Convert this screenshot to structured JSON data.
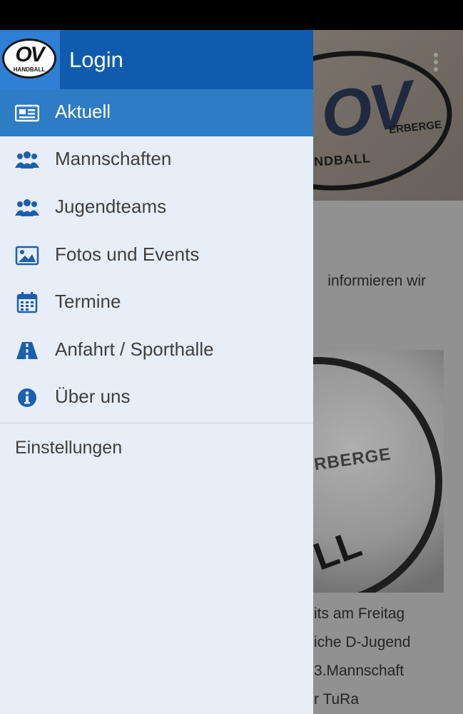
{
  "header": {
    "title": "Login",
    "logo_ov": "OV",
    "logo_handball": "HANDBALL"
  },
  "nav": {
    "items": [
      {
        "label": "Aktuell",
        "icon": "newspaper-icon",
        "active": true
      },
      {
        "label": "Mannschaften",
        "icon": "users-icon"
      },
      {
        "label": "Jugendteams",
        "icon": "users-icon"
      },
      {
        "label": "Fotos und Events",
        "icon": "image-icon"
      },
      {
        "label": "Termine",
        "icon": "calendar-icon"
      },
      {
        "label": "Anfahrt / Sporthalle",
        "icon": "road-icon"
      },
      {
        "label": "Über uns",
        "icon": "info-icon"
      }
    ],
    "settings_label": "Einstellungen"
  },
  "background": {
    "hero": {
      "logo_ov": "OV",
      "logo_erberge": "ERBERGE",
      "logo_handball": "NDBALL"
    },
    "intro_line": "informieren wir",
    "intro_end": ".",
    "image_text": {
      "erberge": "RBERGE",
      "ll": "LL"
    },
    "news_lines": [
      "its am Freitag",
      "iche D-Jugend",
      "3.Mannschaft",
      "r TuRa"
    ]
  },
  "colors": {
    "header": "#0f5cae",
    "active_item": "#2e7cc4",
    "icon": "#1d5fae",
    "drawer_bg": "#e8eef7"
  }
}
